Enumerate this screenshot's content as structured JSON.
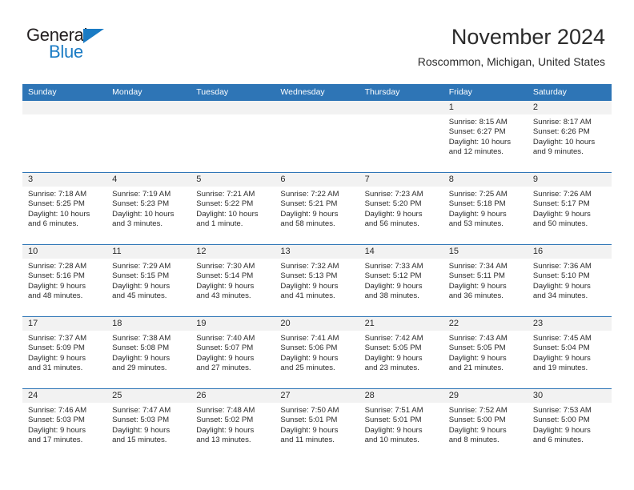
{
  "brand": {
    "name_part1": "General",
    "name_part2": "Blue",
    "triangle_icon": "triangle-icon",
    "accent_color": "#1a7bc4"
  },
  "header": {
    "title": "November 2024",
    "subtitle": "Roscommon, Michigan, United States"
  },
  "calendar": {
    "header_bg": "#2e75b6",
    "date_band_bg": "#f2f2f2",
    "weekdays": [
      "Sunday",
      "Monday",
      "Tuesday",
      "Wednesday",
      "Thursday",
      "Friday",
      "Saturday"
    ],
    "weeks": [
      [
        {
          "day": "",
          "sunrise": "",
          "sunset": "",
          "daylight1": "",
          "daylight2": ""
        },
        {
          "day": "",
          "sunrise": "",
          "sunset": "",
          "daylight1": "",
          "daylight2": ""
        },
        {
          "day": "",
          "sunrise": "",
          "sunset": "",
          "daylight1": "",
          "daylight2": ""
        },
        {
          "day": "",
          "sunrise": "",
          "sunset": "",
          "daylight1": "",
          "daylight2": ""
        },
        {
          "day": "",
          "sunrise": "",
          "sunset": "",
          "daylight1": "",
          "daylight2": ""
        },
        {
          "day": "1",
          "sunrise": "Sunrise: 8:15 AM",
          "sunset": "Sunset: 6:27 PM",
          "daylight1": "Daylight: 10 hours",
          "daylight2": "and 12 minutes."
        },
        {
          "day": "2",
          "sunrise": "Sunrise: 8:17 AM",
          "sunset": "Sunset: 6:26 PM",
          "daylight1": "Daylight: 10 hours",
          "daylight2": "and 9 minutes."
        }
      ],
      [
        {
          "day": "3",
          "sunrise": "Sunrise: 7:18 AM",
          "sunset": "Sunset: 5:25 PM",
          "daylight1": "Daylight: 10 hours",
          "daylight2": "and 6 minutes."
        },
        {
          "day": "4",
          "sunrise": "Sunrise: 7:19 AM",
          "sunset": "Sunset: 5:23 PM",
          "daylight1": "Daylight: 10 hours",
          "daylight2": "and 3 minutes."
        },
        {
          "day": "5",
          "sunrise": "Sunrise: 7:21 AM",
          "sunset": "Sunset: 5:22 PM",
          "daylight1": "Daylight: 10 hours",
          "daylight2": "and 1 minute."
        },
        {
          "day": "6",
          "sunrise": "Sunrise: 7:22 AM",
          "sunset": "Sunset: 5:21 PM",
          "daylight1": "Daylight: 9 hours",
          "daylight2": "and 58 minutes."
        },
        {
          "day": "7",
          "sunrise": "Sunrise: 7:23 AM",
          "sunset": "Sunset: 5:20 PM",
          "daylight1": "Daylight: 9 hours",
          "daylight2": "and 56 minutes."
        },
        {
          "day": "8",
          "sunrise": "Sunrise: 7:25 AM",
          "sunset": "Sunset: 5:18 PM",
          "daylight1": "Daylight: 9 hours",
          "daylight2": "and 53 minutes."
        },
        {
          "day": "9",
          "sunrise": "Sunrise: 7:26 AM",
          "sunset": "Sunset: 5:17 PM",
          "daylight1": "Daylight: 9 hours",
          "daylight2": "and 50 minutes."
        }
      ],
      [
        {
          "day": "10",
          "sunrise": "Sunrise: 7:28 AM",
          "sunset": "Sunset: 5:16 PM",
          "daylight1": "Daylight: 9 hours",
          "daylight2": "and 48 minutes."
        },
        {
          "day": "11",
          "sunrise": "Sunrise: 7:29 AM",
          "sunset": "Sunset: 5:15 PM",
          "daylight1": "Daylight: 9 hours",
          "daylight2": "and 45 minutes."
        },
        {
          "day": "12",
          "sunrise": "Sunrise: 7:30 AM",
          "sunset": "Sunset: 5:14 PM",
          "daylight1": "Daylight: 9 hours",
          "daylight2": "and 43 minutes."
        },
        {
          "day": "13",
          "sunrise": "Sunrise: 7:32 AM",
          "sunset": "Sunset: 5:13 PM",
          "daylight1": "Daylight: 9 hours",
          "daylight2": "and 41 minutes."
        },
        {
          "day": "14",
          "sunrise": "Sunrise: 7:33 AM",
          "sunset": "Sunset: 5:12 PM",
          "daylight1": "Daylight: 9 hours",
          "daylight2": "and 38 minutes."
        },
        {
          "day": "15",
          "sunrise": "Sunrise: 7:34 AM",
          "sunset": "Sunset: 5:11 PM",
          "daylight1": "Daylight: 9 hours",
          "daylight2": "and 36 minutes."
        },
        {
          "day": "16",
          "sunrise": "Sunrise: 7:36 AM",
          "sunset": "Sunset: 5:10 PM",
          "daylight1": "Daylight: 9 hours",
          "daylight2": "and 34 minutes."
        }
      ],
      [
        {
          "day": "17",
          "sunrise": "Sunrise: 7:37 AM",
          "sunset": "Sunset: 5:09 PM",
          "daylight1": "Daylight: 9 hours",
          "daylight2": "and 31 minutes."
        },
        {
          "day": "18",
          "sunrise": "Sunrise: 7:38 AM",
          "sunset": "Sunset: 5:08 PM",
          "daylight1": "Daylight: 9 hours",
          "daylight2": "and 29 minutes."
        },
        {
          "day": "19",
          "sunrise": "Sunrise: 7:40 AM",
          "sunset": "Sunset: 5:07 PM",
          "daylight1": "Daylight: 9 hours",
          "daylight2": "and 27 minutes."
        },
        {
          "day": "20",
          "sunrise": "Sunrise: 7:41 AM",
          "sunset": "Sunset: 5:06 PM",
          "daylight1": "Daylight: 9 hours",
          "daylight2": "and 25 minutes."
        },
        {
          "day": "21",
          "sunrise": "Sunrise: 7:42 AM",
          "sunset": "Sunset: 5:05 PM",
          "daylight1": "Daylight: 9 hours",
          "daylight2": "and 23 minutes."
        },
        {
          "day": "22",
          "sunrise": "Sunrise: 7:43 AM",
          "sunset": "Sunset: 5:05 PM",
          "daylight1": "Daylight: 9 hours",
          "daylight2": "and 21 minutes."
        },
        {
          "day": "23",
          "sunrise": "Sunrise: 7:45 AM",
          "sunset": "Sunset: 5:04 PM",
          "daylight1": "Daylight: 9 hours",
          "daylight2": "and 19 minutes."
        }
      ],
      [
        {
          "day": "24",
          "sunrise": "Sunrise: 7:46 AM",
          "sunset": "Sunset: 5:03 PM",
          "daylight1": "Daylight: 9 hours",
          "daylight2": "and 17 minutes."
        },
        {
          "day": "25",
          "sunrise": "Sunrise: 7:47 AM",
          "sunset": "Sunset: 5:03 PM",
          "daylight1": "Daylight: 9 hours",
          "daylight2": "and 15 minutes."
        },
        {
          "day": "26",
          "sunrise": "Sunrise: 7:48 AM",
          "sunset": "Sunset: 5:02 PM",
          "daylight1": "Daylight: 9 hours",
          "daylight2": "and 13 minutes."
        },
        {
          "day": "27",
          "sunrise": "Sunrise: 7:50 AM",
          "sunset": "Sunset: 5:01 PM",
          "daylight1": "Daylight: 9 hours",
          "daylight2": "and 11 minutes."
        },
        {
          "day": "28",
          "sunrise": "Sunrise: 7:51 AM",
          "sunset": "Sunset: 5:01 PM",
          "daylight1": "Daylight: 9 hours",
          "daylight2": "and 10 minutes."
        },
        {
          "day": "29",
          "sunrise": "Sunrise: 7:52 AM",
          "sunset": "Sunset: 5:00 PM",
          "daylight1": "Daylight: 9 hours",
          "daylight2": "and 8 minutes."
        },
        {
          "day": "30",
          "sunrise": "Sunrise: 7:53 AM",
          "sunset": "Sunset: 5:00 PM",
          "daylight1": "Daylight: 9 hours",
          "daylight2": "and 6 minutes."
        }
      ]
    ]
  }
}
